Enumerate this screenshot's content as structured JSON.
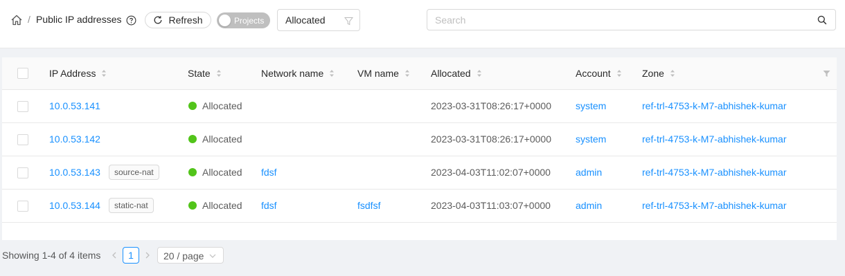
{
  "header": {
    "separator": "/",
    "title": "Public IP addresses",
    "refresh_label": "Refresh",
    "projects_toggle_label": "Projects",
    "projects_toggle_on": false,
    "filter_value": "Allocated",
    "search_placeholder": "Search"
  },
  "table": {
    "columns": [
      "IP Address",
      "State",
      "Network name",
      "VM name",
      "Allocated",
      "Account",
      "Zone"
    ],
    "rows": [
      {
        "ip": "10.0.53.141",
        "tag": "",
        "state": "Allocated",
        "network": "",
        "vm": "",
        "allocated": "2023-03-31T08:26:17+0000",
        "account": "system",
        "zone": "ref-trl-4753-k-M7-abhishek-kumar"
      },
      {
        "ip": "10.0.53.142",
        "tag": "",
        "state": "Allocated",
        "network": "",
        "vm": "",
        "allocated": "2023-03-31T08:26:17+0000",
        "account": "system",
        "zone": "ref-trl-4753-k-M7-abhishek-kumar"
      },
      {
        "ip": "10.0.53.143",
        "tag": "source-nat",
        "state": "Allocated",
        "network": "fdsf",
        "vm": "",
        "allocated": "2023-04-03T11:02:07+0000",
        "account": "admin",
        "zone": "ref-trl-4753-k-M7-abhishek-kumar"
      },
      {
        "ip": "10.0.53.144",
        "tag": "static-nat",
        "state": "Allocated",
        "network": "fdsf",
        "vm": "fsdfsf",
        "allocated": "2023-04-03T11:03:07+0000",
        "account": "admin",
        "zone": "ref-trl-4753-k-M7-abhishek-kumar"
      }
    ]
  },
  "pagination": {
    "total_text": "Showing 1-4 of 4 items",
    "current_page": "1",
    "page_size": "20 / page"
  },
  "colors": {
    "link": "#1890ff",
    "status_allocated": "#52c41a",
    "toggle_off": "#bfbfbf",
    "page_bg": "#f0f2f5"
  },
  "icons": [
    "home-icon",
    "question-circle-icon",
    "reload-icon",
    "filter-icon",
    "search-icon",
    "sort-icon",
    "chevron-left-icon",
    "chevron-right-icon",
    "chevron-down-icon"
  ]
}
